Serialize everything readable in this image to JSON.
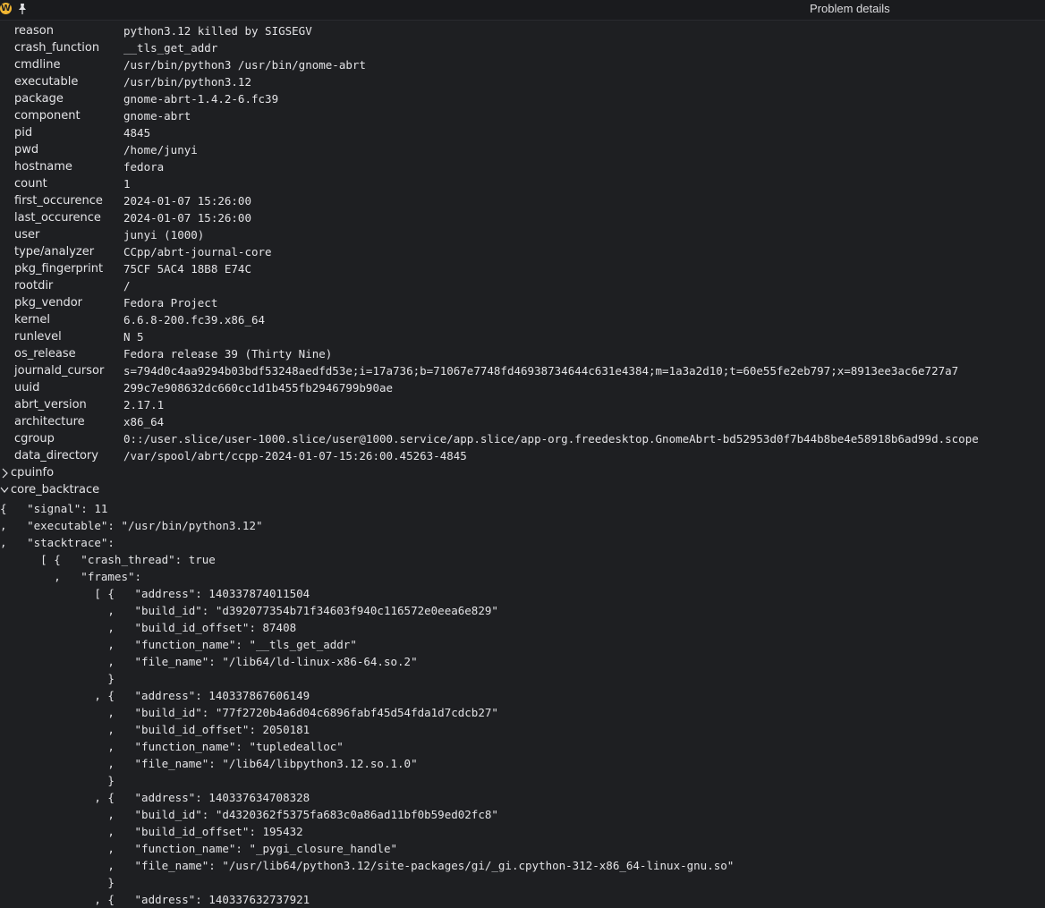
{
  "window": {
    "title": "Problem details",
    "app_icon_letter": "W"
  },
  "fields": [
    {
      "key": "reason",
      "value": "python3.12 killed by SIGSEGV"
    },
    {
      "key": "crash_function",
      "value": "__tls_get_addr"
    },
    {
      "key": "cmdline",
      "value": "/usr/bin/python3 /usr/bin/gnome-abrt"
    },
    {
      "key": "executable",
      "value": "/usr/bin/python3.12"
    },
    {
      "key": "package",
      "value": "gnome-abrt-1.4.2-6.fc39"
    },
    {
      "key": "component",
      "value": "gnome-abrt"
    },
    {
      "key": "pid",
      "value": "4845"
    },
    {
      "key": "pwd",
      "value": "/home/junyi"
    },
    {
      "key": "hostname",
      "value": "fedora"
    },
    {
      "key": "count",
      "value": "1"
    },
    {
      "key": "first_occurence",
      "value": "2024-01-07 15:26:00"
    },
    {
      "key": "last_occurence",
      "value": "2024-01-07 15:26:00"
    },
    {
      "key": "user",
      "value": "junyi (1000)"
    },
    {
      "key": "type/analyzer",
      "value": "CCpp/abrt-journal-core"
    },
    {
      "key": "pkg_fingerprint",
      "value": "75CF 5AC4 18B8 E74C"
    },
    {
      "key": "rootdir",
      "value": "/"
    },
    {
      "key": "pkg_vendor",
      "value": "Fedora Project"
    },
    {
      "key": "kernel",
      "value": "6.6.8-200.fc39.x86_64"
    },
    {
      "key": "runlevel",
      "value": "N 5"
    },
    {
      "key": "os_release",
      "value": "Fedora release 39 (Thirty Nine)"
    },
    {
      "key": "journald_cursor",
      "value": "s=794d0c4aa9294b03bdf53248aedfd53e;i=17a736;b=71067e7748fd46938734644c631e4384;m=1a3a2d10;t=60e55fe2eb797;x=8913ee3ac6e727a7"
    },
    {
      "key": "uuid",
      "value": "299c7e908632dc660cc1d1b455fb2946799b90ae"
    },
    {
      "key": "abrt_version",
      "value": "2.17.1"
    },
    {
      "key": "architecture",
      "value": "x86_64"
    },
    {
      "key": "cgroup",
      "value": "0::/user.slice/user-1000.slice/user@1000.service/app.slice/app-org.freedesktop.GnomeAbrt-bd52953d0f7b44b8be4e58918b6ad99d.scope"
    },
    {
      "key": "data_directory",
      "value": "/var/spool/abrt/ccpp-2024-01-07-15:26:00.45263-4845"
    }
  ],
  "sections": {
    "cpuinfo": {
      "label": "cpuinfo",
      "expanded": false
    },
    "core_backtrace": {
      "label": "core_backtrace",
      "expanded": true
    }
  },
  "core_backtrace_lines": [
    "{   \"signal\": 11",
    ",   \"executable\": \"/usr/bin/python3.12\"",
    ",   \"stacktrace\":",
    "      [ {   \"crash_thread\": true",
    "        ,   \"frames\":",
    "              [ {   \"address\": 140337874011504",
    "                ,   \"build_id\": \"d392077354b71f34603f940c116572e0eea6e829\"",
    "                ,   \"build_id_offset\": 87408",
    "                ,   \"function_name\": \"__tls_get_addr\"",
    "                ,   \"file_name\": \"/lib64/ld-linux-x86-64.so.2\"",
    "                }",
    "              , {   \"address\": 140337867606149",
    "                ,   \"build_id\": \"77f2720b4a6d04c6896fabf45d54fda1d7cdcb27\"",
    "                ,   \"build_id_offset\": 2050181",
    "                ,   \"function_name\": \"tupledealloc\"",
    "                ,   \"file_name\": \"/lib64/libpython3.12.so.1.0\"",
    "                }",
    "              , {   \"address\": 140337634708328",
    "                ,   \"build_id\": \"d4320362f5375fa683c0a86ad11bf0b59ed02fc8\"",
    "                ,   \"build_id_offset\": 195432",
    "                ,   \"function_name\": \"_pygi_closure_handle\"",
    "                ,   \"file_name\": \"/usr/lib64/python3.12/site-packages/gi/_gi.cpython-312-x86_64-linux-gnu.so\"",
    "                }",
    "              , {   \"address\": 140337632737921"
  ]
}
